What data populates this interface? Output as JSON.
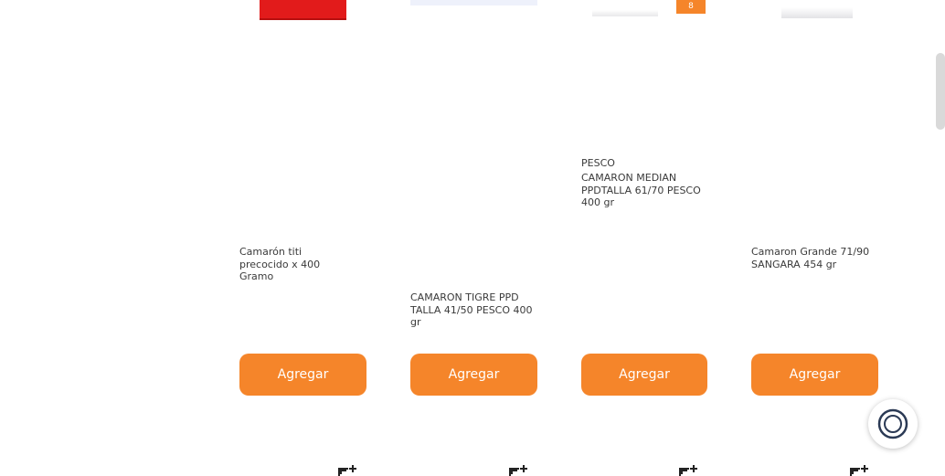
{
  "products": [
    {
      "title": "Camarón titi precocido x 400 Gramo",
      "button": "Agregar"
    },
    {
      "title": "CAMARON TIGRE PPD TALLA 41/50 PESCO 400 gr",
      "button": "Agregar"
    },
    {
      "brand": "PESCO",
      "title": "CAMARON MEDIAN PPDTALLA 61/70 PESCO 400 gr",
      "button": "Agregar",
      "badge": "8"
    },
    {
      "title": "Camaron Grande 71/90 SANGARA 454 gr",
      "button": "Agregar"
    }
  ],
  "colors": {
    "accent": "#f5852a",
    "text": "#3a3a3a"
  },
  "icons": {
    "favorite": "heart-plus-icon",
    "chat": "chat-icon"
  }
}
